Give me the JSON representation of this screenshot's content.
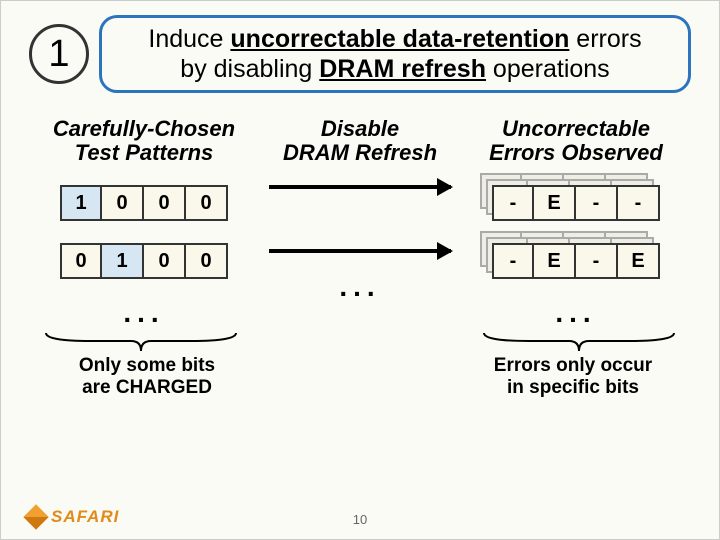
{
  "step": "1",
  "title": {
    "line1_pre": "Induce ",
    "line1_u": "uncorrectable data-retention",
    "line1_post": " errors",
    "line2_pre": "by disabling ",
    "line2_u": "DRAM refresh",
    "line2_post": " operations"
  },
  "left_heading_l1": "Carefully-Chosen",
  "left_heading_l2": "Test Patterns",
  "center_heading_l1": "Disable",
  "center_heading_l2": "DRAM Refresh",
  "right_heading_l1": "Uncorrectable",
  "right_heading_l2": "Errors Observed",
  "pattern1": [
    "1",
    "0",
    "0",
    "0"
  ],
  "pattern2": [
    "0",
    "1",
    "0",
    "0"
  ],
  "errors1": [
    "-",
    "E",
    "-",
    "-"
  ],
  "errors2": [
    "-",
    "E",
    "-",
    "E"
  ],
  "dots": "...",
  "caption_left_l1": "Only some bits",
  "caption_left_l2": "are CHARGED",
  "caption_right_l1": "Errors only occur",
  "caption_right_l2": "in specific bits",
  "page": "10",
  "logo": "SAFARI"
}
